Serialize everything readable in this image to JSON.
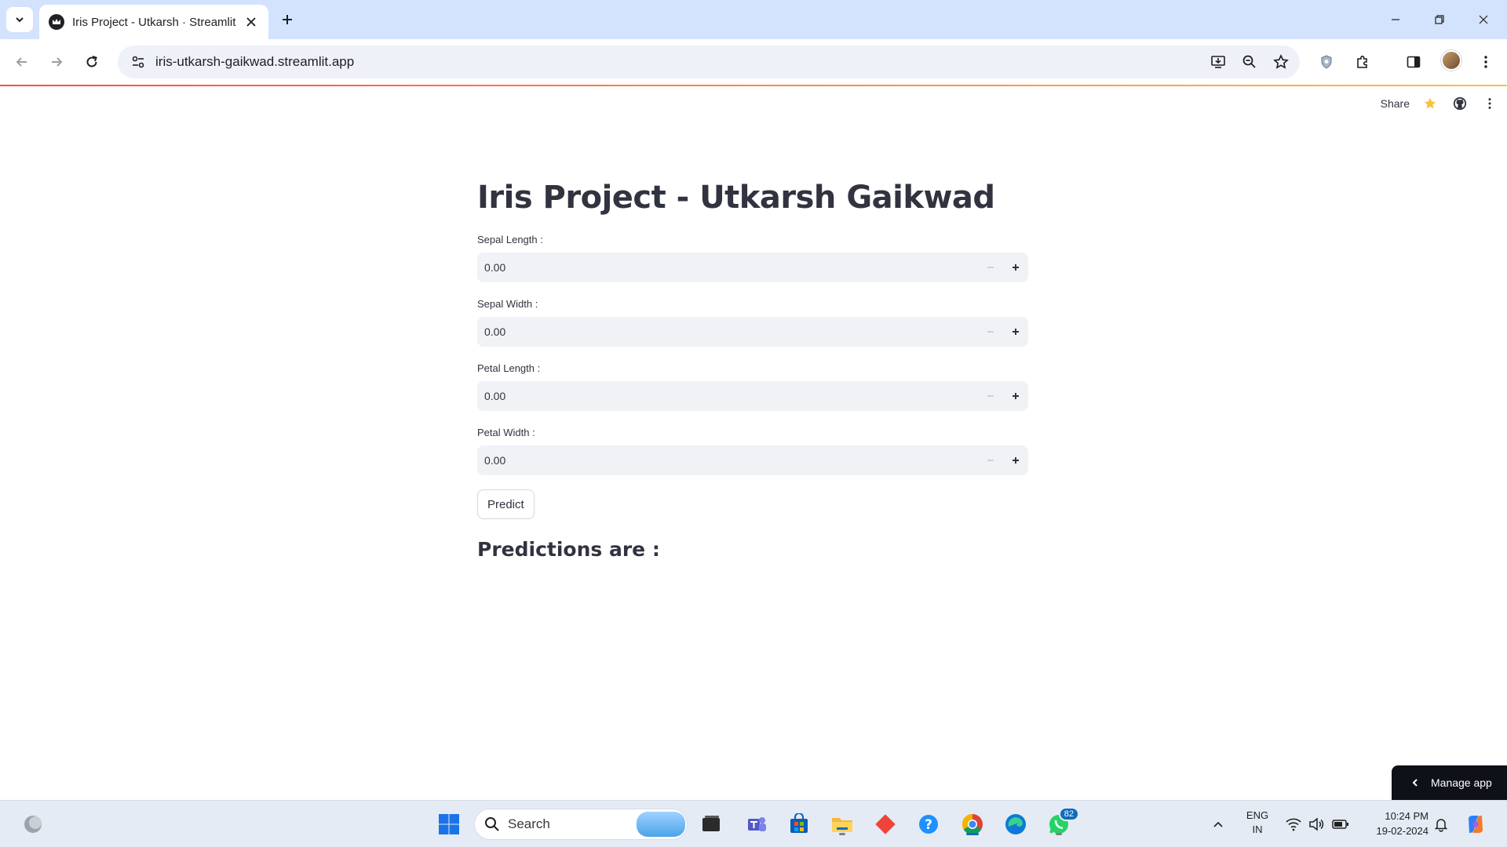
{
  "browser": {
    "tab_title": "Iris Project - Utkarsh · Streamlit",
    "url": "iris-utkarsh-gaikwad.streamlit.app"
  },
  "app": {
    "header": {
      "share_label": "Share"
    },
    "title": "Iris Project - Utkarsh Gaikwad",
    "fields": [
      {
        "label": "Sepal Length :",
        "value": "0.00"
      },
      {
        "label": "Sepal Width :",
        "value": "0.00"
      },
      {
        "label": "Petal Length :",
        "value": "0.00"
      },
      {
        "label": "Petal Width :",
        "value": "0.00"
      }
    ],
    "predict_label": "Predict",
    "predictions_heading": "Predictions are :",
    "manage_app_label": "Manage app"
  },
  "taskbar": {
    "search_label": "Search",
    "whatsapp_badge": "82",
    "lang_line1": "ENG",
    "lang_line2": "IN",
    "time": "10:24 PM",
    "date": "19-02-2024"
  },
  "colors": {
    "browser_frame": "#d3e3fd",
    "streamlit_text": "#31333f",
    "input_bg": "#f0f2f6",
    "decoration_start": "#ff4b4b",
    "decoration_end": "#ffbd45"
  }
}
